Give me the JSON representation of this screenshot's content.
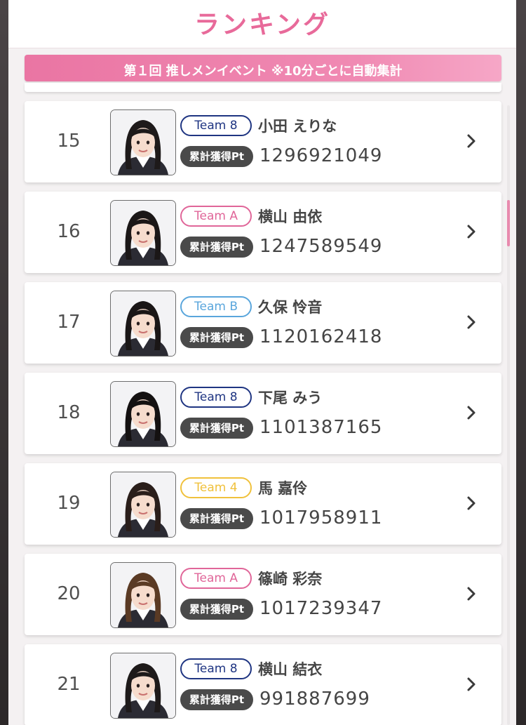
{
  "header": {
    "title": "ランキング"
  },
  "event": {
    "banner": "第１回 推しメンイベント ※10分ごとに自動集計"
  },
  "point_label": "累計獲得Pt",
  "team_colors": {
    "Team 8": "#1f3582",
    "Team A": "#e06699",
    "Team B": "#5aa6dc",
    "Team 4": "#f0c13c"
  },
  "accent_color": "#e86a9a",
  "ranking": [
    {
      "rank": "15",
      "team": "Team 8",
      "name": "小田 えりな",
      "points": "1296921049"
    },
    {
      "rank": "16",
      "team": "Team A",
      "name": "横山 由依",
      "points": "1247589549"
    },
    {
      "rank": "17",
      "team": "Team B",
      "name": "久保 怜音",
      "points": "1120162418"
    },
    {
      "rank": "18",
      "team": "Team 8",
      "name": "下尾 みう",
      "points": "1101387165"
    },
    {
      "rank": "19",
      "team": "Team 4",
      "name": "馬 嘉伶",
      "points": "1017958911"
    },
    {
      "rank": "20",
      "team": "Team A",
      "name": "篠崎 彩奈",
      "points": "1017239347"
    },
    {
      "rank": "21",
      "team": "Team 8",
      "name": "横山 結衣",
      "points": "991887699"
    }
  ],
  "icons": {
    "row_arrow": "chevron-right-icon",
    "photo": "member-photo"
  }
}
